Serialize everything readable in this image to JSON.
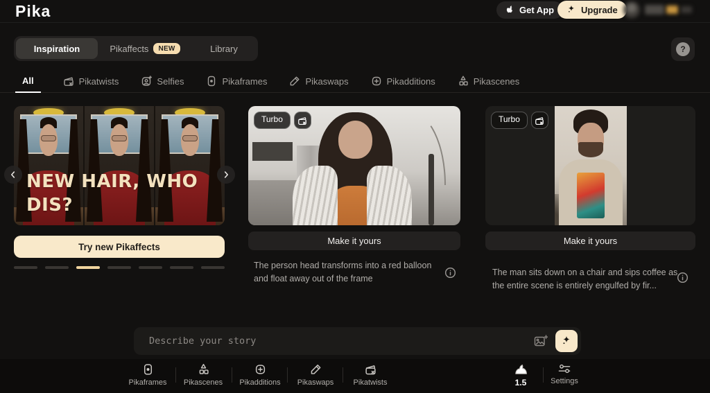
{
  "header": {
    "logo": "Pika",
    "get_app_label": "Get App",
    "upgrade_label": "Upgrade"
  },
  "tabs": {
    "items": [
      {
        "label": "Inspiration",
        "active": true
      },
      {
        "label": "Pikaffects",
        "badge": "NEW"
      },
      {
        "label": "Library"
      }
    ],
    "help_label": "?"
  },
  "categories": {
    "items": [
      {
        "label": "All",
        "icon": "none",
        "active": true
      },
      {
        "label": "Pikatwists",
        "icon": "clapperboard-icon"
      },
      {
        "label": "Selfies",
        "icon": "person-frame-icon"
      },
      {
        "label": "Pikaframes",
        "icon": "frame-dot-icon"
      },
      {
        "label": "Pikaswaps",
        "icon": "pen-swap-icon"
      },
      {
        "label": "Pikadditions",
        "icon": "square-plus-icon"
      },
      {
        "label": "Pikascenes",
        "icon": "shapes-icon"
      }
    ]
  },
  "cards": {
    "promo": {
      "overlay_title": "NEW HAIR, WHO DIS?",
      "cta_label": "Try new Pikaffects",
      "dash_count": 7,
      "active_dash_index": 2
    },
    "examples": [
      {
        "badge": "Turbo",
        "cta_label": "Make it yours",
        "description": "The person head transforms into a red balloon and float away out of the frame"
      },
      {
        "badge": "Turbo",
        "cta_label": "Make it yours",
        "description": "The man sits down on a chair and sips coffee as the entire scene is entirely engulfed by fir..."
      }
    ]
  },
  "prompt_bar": {
    "placeholder": "Describe your story"
  },
  "bottom_nav": {
    "items": [
      {
        "label": "Pikaframes",
        "icon": "frame-dot-icon"
      },
      {
        "label": "Pikascenes",
        "icon": "shapes-icon"
      },
      {
        "label": "Pikadditions",
        "icon": "square-plus-icon"
      },
      {
        "label": "Pikaswaps",
        "icon": "pen-swap-icon"
      },
      {
        "label": "Pikatwists",
        "icon": "clapperboard-icon"
      }
    ],
    "version": "1.5",
    "settings_label": "Settings"
  },
  "colors": {
    "background": "#121110",
    "cream": "#f8e8ca",
    "active_dash": "#f0d49e",
    "badge_new": "#f6ddb0"
  }
}
